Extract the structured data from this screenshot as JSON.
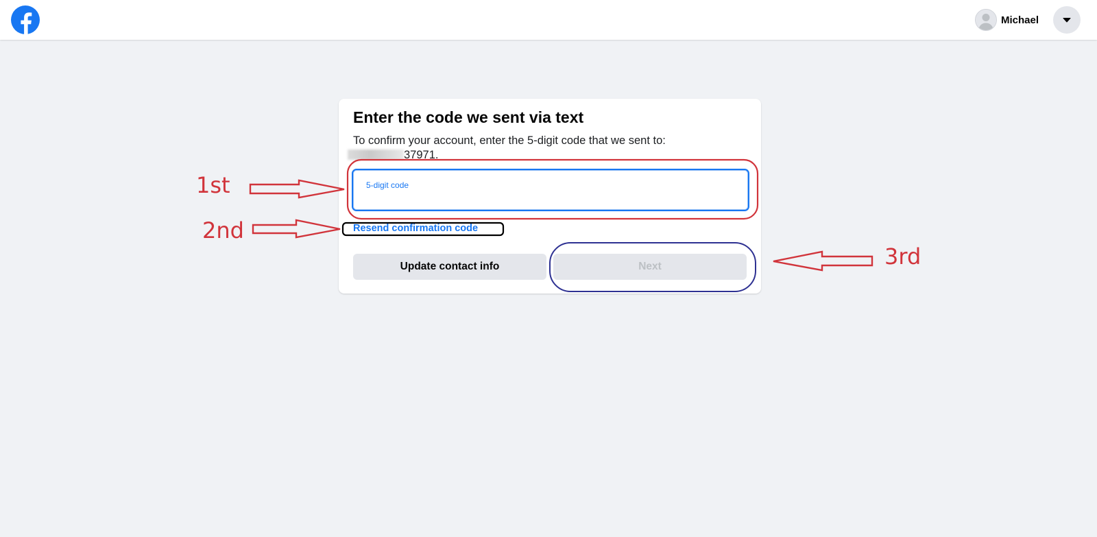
{
  "header": {
    "logo_icon": "facebook-logo-icon",
    "profile_name": "Michael",
    "avatar_icon": "user-avatar-icon",
    "menu_icon": "caret-down-icon",
    "brand_color": "#1877f2"
  },
  "card": {
    "title": "Enter the code we sent via text",
    "description": "To confirm your account, enter the 5-digit code that we sent to:",
    "phone_visible_suffix": "37971.",
    "input": {
      "label": "5-digit code",
      "value": ""
    },
    "resend_label": "Resend confirmation code",
    "update_button_label": "Update contact info",
    "next_button_label": "Next"
  },
  "annotations": {
    "first": "1st",
    "second": "2nd",
    "third": "3rd",
    "colors": {
      "red": "#d1343b",
      "black": "#000000",
      "blue": "#2e3192"
    }
  }
}
